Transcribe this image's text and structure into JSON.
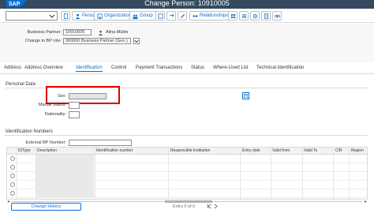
{
  "shell": {
    "logo_text": "SAP",
    "title": "Change Person: 10910005"
  },
  "toolbar": {
    "buttons": [
      {
        "label": "Person",
        "icon": "person-icon"
      },
      {
        "label": "Organization",
        "icon": "organization-icon"
      },
      {
        "label": "Group",
        "icon": "group-icon"
      },
      {
        "label": "Relationships",
        "icon": "relationships-icon"
      }
    ]
  },
  "header": {
    "bp_label": "Business Partner:",
    "bp_value": "10910005",
    "bp_name": "Alina Müller",
    "role_label": "Change in BP role:",
    "role_value": "000000 Business Partner (Gen.)"
  },
  "tabs": [
    "Address",
    "Address Overview",
    "Identification",
    "Control",
    "Payment Transactions",
    "Status",
    "Where-Used List",
    "Technical Identification"
  ],
  "active_tab": "Identification",
  "personal": {
    "title": "Personal Data",
    "sex_label": "Sex:",
    "sex_value": "",
    "marital_label": "Marital Status:",
    "nationality_label": "Nationality:"
  },
  "identification": {
    "title": "Identification Numbers",
    "external_bp_label": "External BP Number:",
    "external_bp_value": "",
    "columns": [
      "IDType",
      "Description",
      "Identification number",
      "Responsible Institution",
      "Entry date",
      "Valid from",
      "Valid To",
      "C/R",
      "Region"
    ],
    "row_count": 5
  },
  "footer": {
    "change_history_label": "Change History",
    "entry_text": "Entry 0 of 0"
  },
  "colors": {
    "shell": "#354a5f",
    "accent": "#0a6ed1",
    "highlight": "#e00000"
  }
}
